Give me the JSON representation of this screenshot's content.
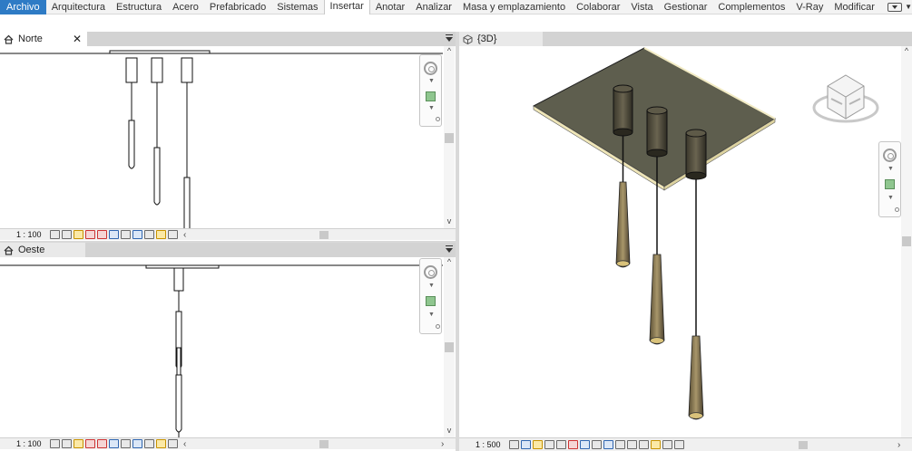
{
  "ribbon": {
    "tabs": [
      {
        "label": "Archivo",
        "state": "file"
      },
      {
        "label": "Arquitectura",
        "state": ""
      },
      {
        "label": "Estructura",
        "state": ""
      },
      {
        "label": "Acero",
        "state": ""
      },
      {
        "label": "Prefabricado",
        "state": ""
      },
      {
        "label": "Sistemas",
        "state": ""
      },
      {
        "label": "Insertar",
        "state": "active"
      },
      {
        "label": "Anotar",
        "state": ""
      },
      {
        "label": "Analizar",
        "state": ""
      },
      {
        "label": "Masa y emplazamiento",
        "state": ""
      },
      {
        "label": "Colaborar",
        "state": ""
      },
      {
        "label": "Vista",
        "state": ""
      },
      {
        "label": "Gestionar",
        "state": ""
      },
      {
        "label": "Complementos",
        "state": ""
      },
      {
        "label": "V-Ray",
        "state": ""
      },
      {
        "label": "Modificar",
        "state": ""
      }
    ]
  },
  "views": {
    "north": {
      "title": "Norte",
      "close": "✕",
      "scale": "1 : 100"
    },
    "west": {
      "title": "Oeste",
      "scale": "1 : 100"
    },
    "threeD": {
      "title": "{3D}",
      "scale": "1 : 500"
    }
  },
  "colors": {
    "file_tab": "#2e7bc5",
    "ceiling_plate": "#5e5e4e",
    "pendant": "#8a7a55"
  },
  "icons": {
    "north_view": "elevation-icon",
    "west_view": "elevation-icon",
    "three_d_view": "3d-view-icon",
    "view_cube": "view-cube-icon"
  }
}
